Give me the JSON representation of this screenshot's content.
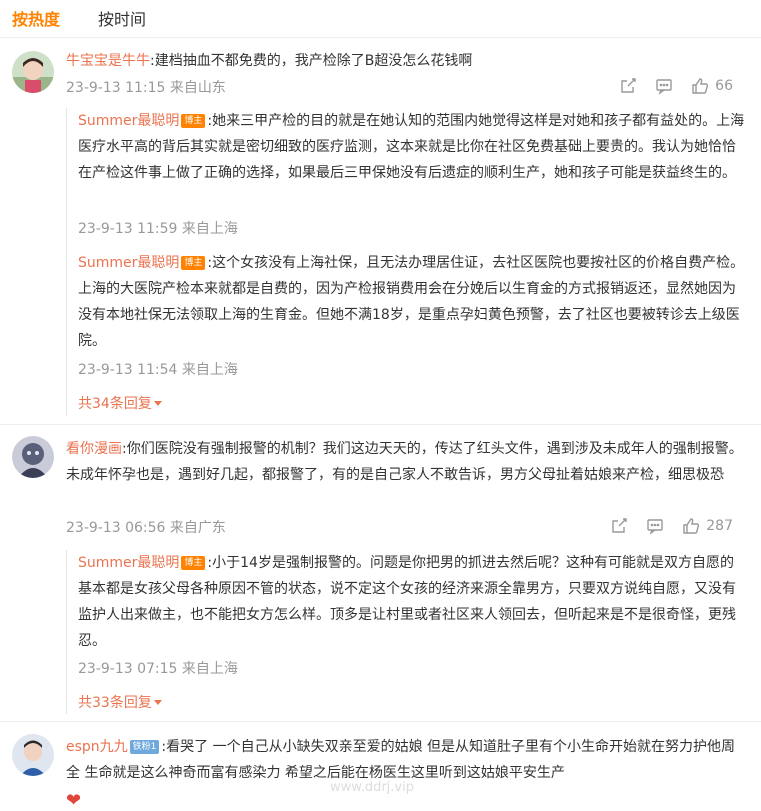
{
  "tabs": {
    "hot": "按热度",
    "time": "按时间"
  },
  "comments": [
    {
      "user": "牛宝宝是牛牛",
      "text": ":建档抽血不都免费的，我产检除了B超没怎么花钱啊",
      "meta": "23-9-13 11:15  来自山东",
      "likes": "66",
      "replies": [
        {
          "user": "Summer最聪明",
          "tag": "博主",
          "text": ":她来三甲产检的目的就是在她认知的范围内她觉得这样是对她和孩子都有益处的。上海医疗水平高的背后其实就是密切细致的医疗监测，这本来就是比你在社区免费基础上要贵的。我认为她恰恰在产检这件事上做了正确的选择，如果最后三甲保她没有后遗症的顺利生产，她和孩子可能是获益终生的。",
          "meta": "23-9-13 11:59  来自上海"
        },
        {
          "user": "Summer最聪明",
          "tag": "博主",
          "text": ":这个女孩没有上海社保，且无法办理居住证，去社区医院也要按社区的价格自费产检。上海的大医院产检本来就都是自费的，因为产检报销费用会在分娩后以生育金的方式报销返还，显然她因为没有本地社保无法领取上海的生育金。但她不满18岁，是重点孕妇黄色预警，去了社区也要被转诊去上级医院。",
          "meta": "23-9-13 11:54  来自上海"
        }
      ],
      "more": "共34条回复"
    },
    {
      "user": "看你漫画",
      "text": ":你们医院没有强制报警的机制？我们这边天天的，传达了红头文件，遇到涉及未成年人的强制报警。未成年怀孕也是，遇到好几起，都报警了，有的是自己家人不敢告诉，男方父母扯着姑娘来产检，细思极恐",
      "meta": "23-9-13 06:56  来自广东",
      "likes": "287",
      "replies": [
        {
          "user": "Summer最聪明",
          "tag": "博主",
          "text": ":小于14岁是强制报警的。问题是你把男的抓进去然后呢？这种有可能就是双方自愿的基本都是女孩父母各种原因不管的状态，说不定这个女孩的经济来源全靠男方，只要双方说纯自愿，又没有监护人出来做主，也不能把女方怎么样。顶多是让村里或者社区来人领回去，但听起来是不是很奇怪，更残忍。",
          "meta": "23-9-13 07:15  来自上海"
        }
      ],
      "more": "共33条回复"
    },
    {
      "user": "espn九九",
      "tag": "铁粉1",
      "text": ":看哭了 一个自己从小缺失双亲至爱的姑娘 但是从知道肚子里有个小生命开始就在努力护他周全 生命就是这么神奇而富有感染力 希望之后能在杨医生这里听到这姑娘平安生产",
      "emoji": "❤"
    }
  ],
  "icons": [
    "share-icon",
    "comment-icon",
    "like-icon",
    "heart-emoji"
  ],
  "watermark": "www.ddrj.vip",
  "colors": {
    "accent": "#ff8200",
    "username": "#eb7350",
    "meta": "#999999"
  }
}
